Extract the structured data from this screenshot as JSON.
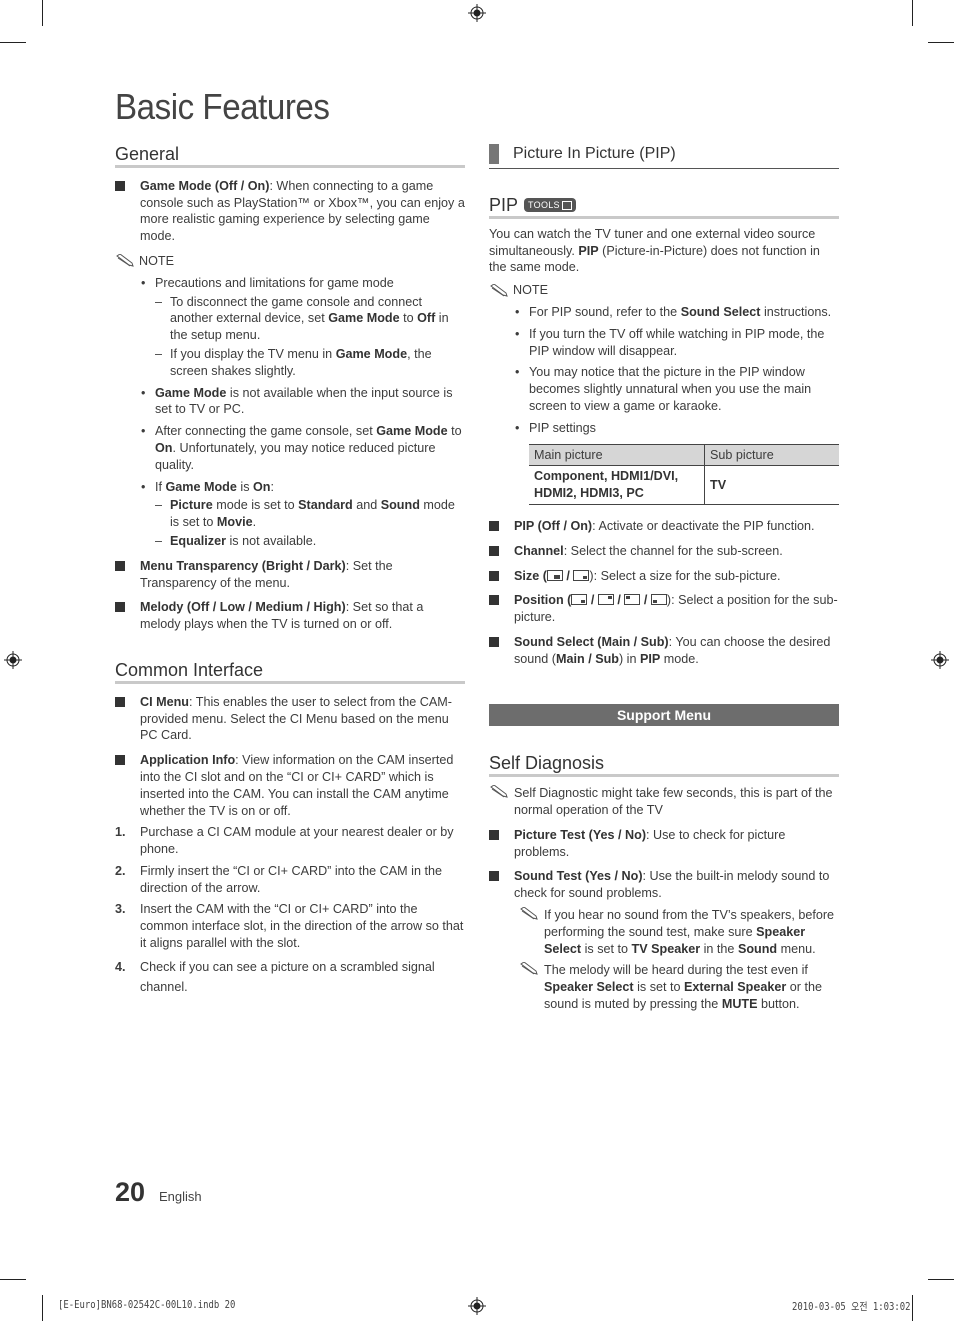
{
  "page": {
    "title": "Basic Features",
    "page_number": "20",
    "language": "English",
    "print_info_left": "[E-Euro]BN68-02542C-00L10.indb   20",
    "print_info_right": "2010-03-05   오전 1:03:02"
  },
  "left": {
    "general": {
      "heading": "General",
      "game_mode": {
        "label": "Game Mode (Off / On)",
        "text": ": When connecting to a game console such as PlayStation™ or Xbox™, you can enjoy a more realistic gaming experience by selecting game mode."
      },
      "note_label": "NOTE",
      "notes": {
        "b1": "Precautions and limitations for game mode",
        "b1_d1_a": "To disconnect the game console and connect another external device, set ",
        "b1_d1_b": "Game Mode",
        "b1_d1_c": " to ",
        "b1_d1_d": "Off",
        "b1_d1_e": " in the setup menu.",
        "b1_d2_a": "If you display the TV menu in ",
        "b1_d2_b": "Game Mode",
        "b1_d2_c": ", the screen shakes slightly.",
        "b2_a": "Game Mode",
        "b2_b": " is not available when the input source is set to TV or PC.",
        "b3_a": "After connecting the game console, set ",
        "b3_b": "Game Mode",
        "b3_c": " to ",
        "b3_d": "On",
        "b3_e": ". Unfortunately, you may notice reduced picture quality.",
        "b4_a": "If ",
        "b4_b": "Game Mode",
        "b4_c": " is ",
        "b4_d": "On",
        "b4_e": ":",
        "b4_d1_a": "Picture",
        "b4_d1_b": " mode is set to ",
        "b4_d1_c": "Standard",
        "b4_d1_d": " and ",
        "b4_d1_e": "Sound",
        "b4_d1_f": " mode is set to ",
        "b4_d1_g": "Movie",
        "b4_d1_h": ".",
        "b4_d2_a": "Equalizer",
        "b4_d2_b": " is not available."
      },
      "menu_transparency": {
        "label": "Menu Transparency (Bright / Dark)",
        "text": ": Set the Transparency of the menu."
      },
      "melody": {
        "label": "Melody (Off / Low / Medium / High)",
        "text": ": Set so that a melody plays when the TV is turned on or off."
      }
    },
    "common_interface": {
      "heading": "Common Interface",
      "ci_menu": {
        "label": "CI Menu",
        "text": ": This enables the user to select from the CAM-provided menu. Select the CI Menu based on the menu PC Card."
      },
      "app_info": {
        "label": "Application Info",
        "text": ": View information on the CAM inserted into the CI slot and on the “CI or CI+ CARD” which is inserted into the CAM. You can install the CAM anytime whether the TV is on or off."
      },
      "steps": [
        {
          "n": "1.",
          "text": "Purchase a CI CAM module at your nearest dealer or by phone."
        },
        {
          "n": "2.",
          "text": "Firmly insert the “CI or CI+ CARD” into the CAM in the direction of the arrow."
        },
        {
          "n": "3.",
          "text": "Insert the CAM with the “CI or CI+ CARD” into the common interface slot, in the direction of the arrow so that it aligns parallel with the slot."
        },
        {
          "n": "4.",
          "text": "Check if you can see a picture on a scrambled signal channel."
        }
      ]
    }
  },
  "right": {
    "pip_section": {
      "heading": "Picture In Picture (PIP)",
      "pip_heading": "PIP",
      "tools_badge": "TOOLS",
      "intro_a": "You can watch the TV tuner and one external video source simultaneously. ",
      "intro_b": "PIP",
      "intro_c": " (Picture-in-Picture) does not function in the same mode.",
      "note_label": "NOTE",
      "notes": {
        "n1_a": "For PIP sound, refer to the ",
        "n1_b": "Sound Select",
        "n1_c": " instructions.",
        "n2": "If you turn the TV off while watching in PIP mode, the PIP window will disappear.",
        "n3": "You may notice that the picture in the PIP window becomes slightly unnatural when you use the main screen to view a game or karaoke.",
        "n4": "PIP settings"
      },
      "table": {
        "headers": [
          "Main picture",
          "Sub picture"
        ],
        "rows": [
          [
            "Component, HDMI1/DVI, HDMI2, HDMI3, PC",
            "TV"
          ]
        ]
      },
      "items": {
        "pip_label": "PIP (Off / On)",
        "pip_text": ": Activate or deactivate the PIP function.",
        "channel_label": "Channel",
        "channel_text": ": Select the channel for the sub-screen.",
        "size_label": "Size (",
        "size_sep": " / ",
        "size_text": "): Select a size for the sub-picture.",
        "position_label": "Position (",
        "position_sep": " / ",
        "position_text": "): Select a position for the sub-picture.",
        "sound_label": "Sound Select (Main / Sub)",
        "sound_text_a": ": You can choose the desired sound (",
        "sound_text_b": "Main / Sub",
        "sound_text_c": ") in ",
        "sound_text_d": "PIP",
        "sound_text_e": " mode."
      }
    },
    "support_menu": {
      "banner": "Support Menu",
      "self_diagnosis": {
        "heading": "Self Diagnosis",
        "note": "Self Diagnostic might take few seconds, this is part of the normal operation of the TV",
        "picture_test_label": "Picture Test (Yes / No)",
        "picture_test_text": ": Use to check for picture problems.",
        "sound_test_label": "Sound Test (Yes / No)",
        "sound_test_text": ": Use the built-in melody sound to check for sound problems.",
        "note1_a": "If you hear no sound from the TV’s speakers, before performing the sound test, make sure ",
        "note1_b": "Speaker Select",
        "note1_c": " is set to ",
        "note1_d": "TV Speaker",
        "note1_e": " in the ",
        "note1_f": "Sound",
        "note1_g": " menu.",
        "note2_a": "The melody will be heard during the test even if ",
        "note2_b": "Speaker Select",
        "note2_c": " is set to ",
        "note2_d": "External Speaker",
        "note2_e": " or the sound is muted by pressing the ",
        "note2_f": "MUTE",
        "note2_g": " button."
      }
    }
  }
}
